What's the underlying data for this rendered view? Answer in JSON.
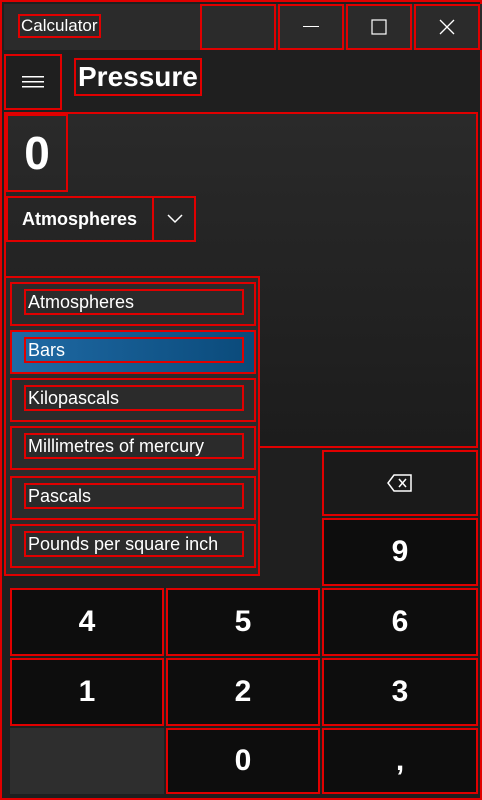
{
  "window": {
    "title": "Calculator",
    "controls": {
      "minimize": "—",
      "maximize": "☐",
      "close": "✕"
    }
  },
  "header": {
    "menu_icon": "≡",
    "mode": "Pressure"
  },
  "display": {
    "value": "0",
    "unit": "Atmospheres",
    "chevron": "⌄"
  },
  "dropdown": {
    "items": [
      {
        "label": "Atmospheres",
        "selected": false
      },
      {
        "label": "Bars",
        "selected": true
      },
      {
        "label": "Kilopascals",
        "selected": false
      },
      {
        "label": "Millimetres of mercury",
        "selected": false
      },
      {
        "label": "Pascals",
        "selected": false
      },
      {
        "label": "Pounds per square inch",
        "selected": false
      }
    ]
  },
  "keypad": {
    "backspace": "⌫",
    "k9": "9",
    "k4": "4",
    "k5": "5",
    "k6": "6",
    "k1": "1",
    "k2": "2",
    "k3": "3",
    "k0": "0",
    "decimal": ","
  }
}
